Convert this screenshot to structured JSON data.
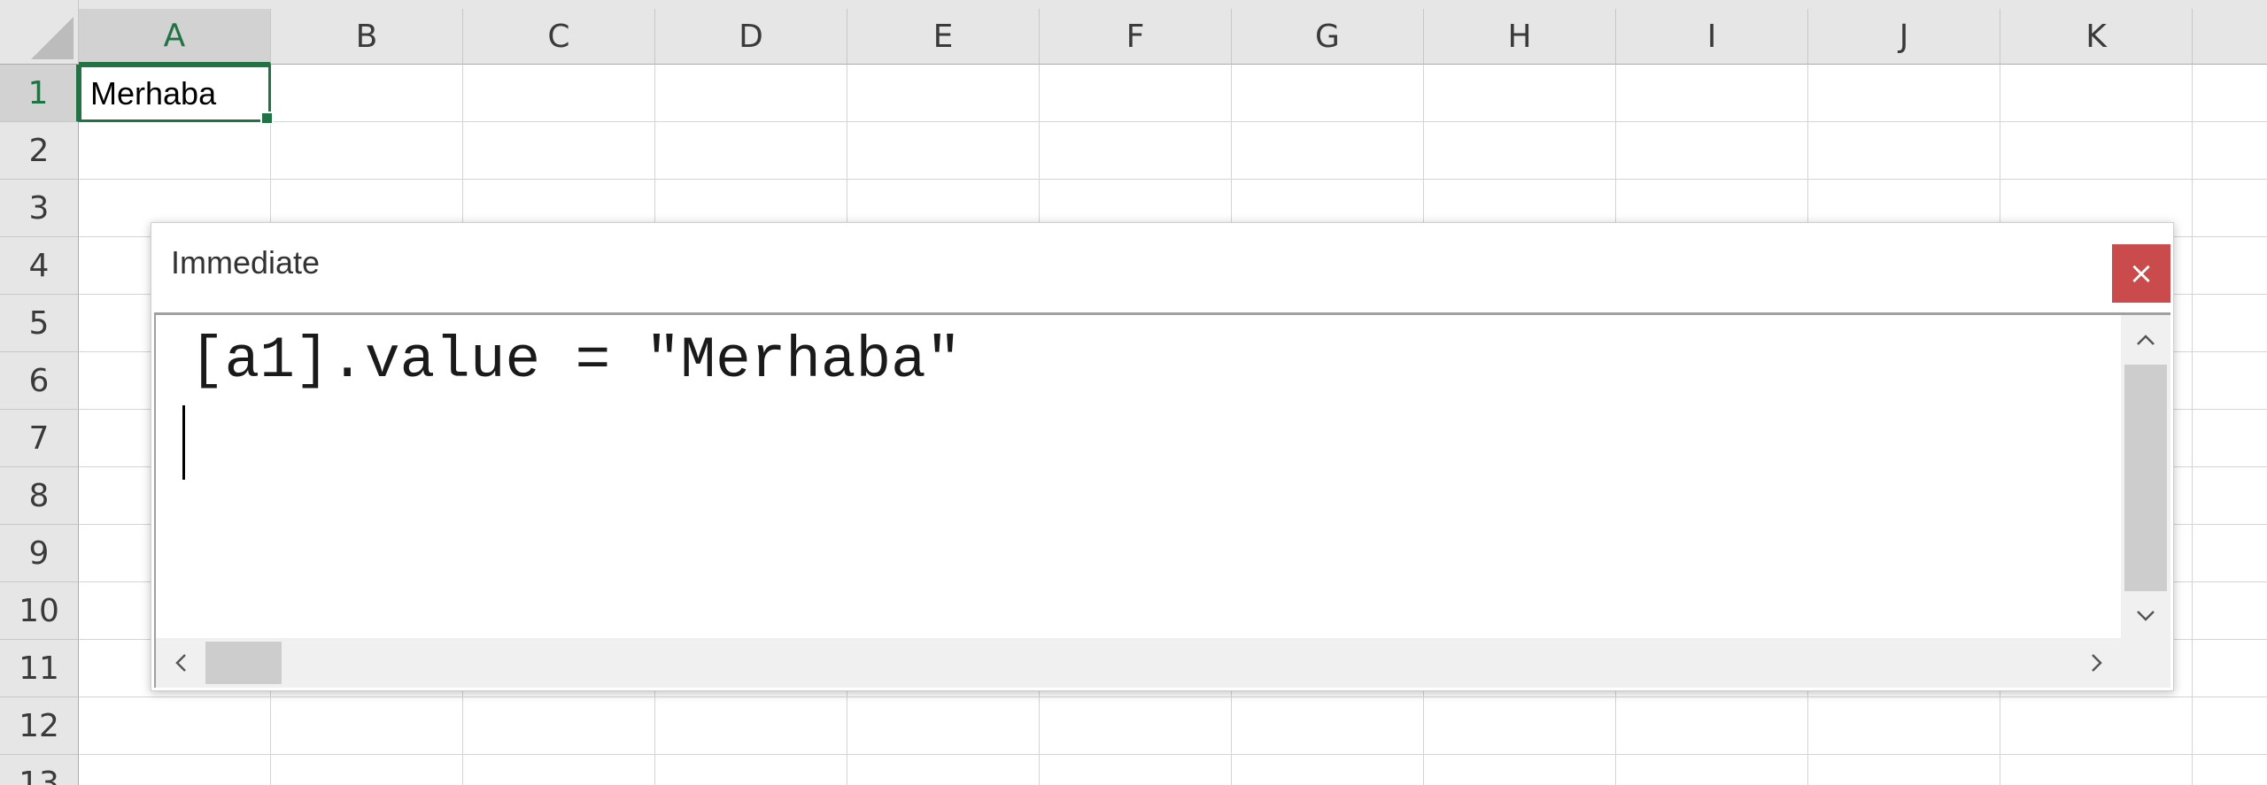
{
  "spreadsheet": {
    "columns": [
      "A",
      "B",
      "C",
      "D",
      "E",
      "F",
      "G",
      "H",
      "I",
      "J",
      "K"
    ],
    "rows": [
      "1",
      "2",
      "3",
      "4",
      "5",
      "6",
      "7",
      "8",
      "9",
      "10",
      "11",
      "12",
      "13"
    ],
    "selected_column": "A",
    "selected_row": "1",
    "cell_a1_value": "Merhaba",
    "accent_color": "#217346"
  },
  "immediate_window": {
    "title": "Immediate",
    "close_glyph": "×",
    "code_lines": [
      "[a1].value = \"Merhaba\"",
      ""
    ],
    "close_color": "#c94b4b",
    "icons": {
      "close": "close-icon",
      "scroll_up": "chevron-up-icon",
      "scroll_down": "chevron-down-icon",
      "scroll_left": "chevron-left-icon",
      "scroll_right": "chevron-right-icon"
    }
  }
}
